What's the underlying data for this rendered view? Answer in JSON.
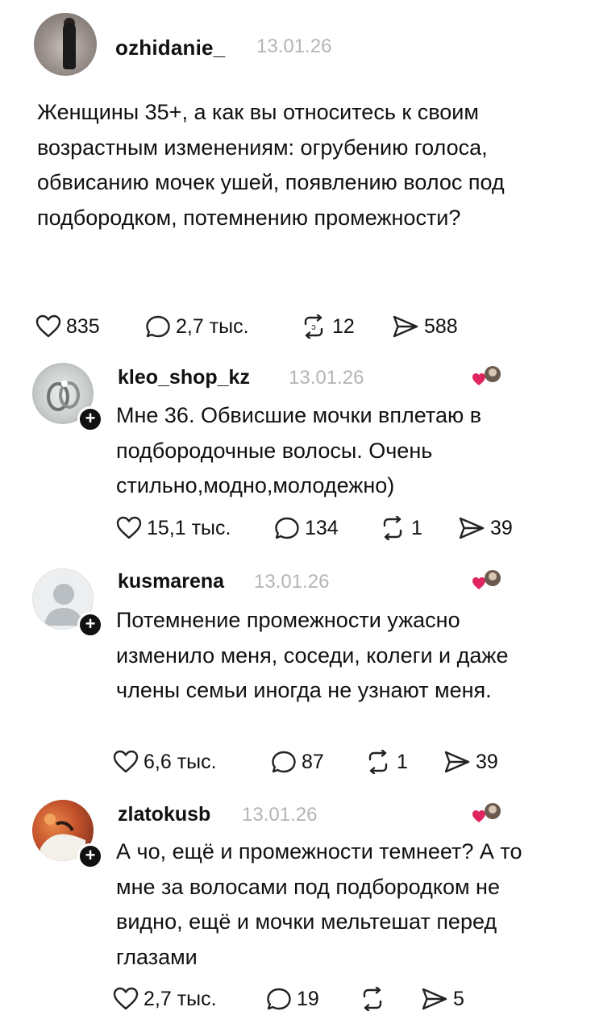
{
  "post": {
    "username": "ozhidanie_",
    "date": "13.01.26",
    "text": "Женщины 35+, а как вы относитесь к своим возрастным изменениям: огрубению голоса,  обвисанию мочек ушей, появлению волос под подбородком, потемнению промежности?",
    "likes": "835",
    "replies": "2,7 тыс.",
    "reposts": "12",
    "shares": "588"
  },
  "comments": [
    {
      "username": "kleo_shop_kz",
      "date": "13.01.26",
      "text": "Мне 36. Обвисшие мочки вплетаю в подбородочные волосы.  Очень стильно,модно,молодежно)",
      "likes": "15,1 тыс.",
      "replies": "134",
      "reposts": "1",
      "shares": "39"
    },
    {
      "username": "kusmarena",
      "date": "13.01.26",
      "text": "Потемнение промежности ужасно изменило меня,  соседи, колеги и даже члены семьи иногда не узнают меня.",
      "likes": "6,6 тыс.",
      "replies": "87",
      "reposts": "1",
      "shares": "39"
    },
    {
      "username": "zlatokusb",
      "date": "13.01.26",
      "text": "А чо, ещё и промежности темнеет? А то мне за волосами под подбородком не видно, ещё и мочки мельтешат перед глазами",
      "likes": "2,7 тыс.",
      "replies": "19",
      "reposts": "",
      "shares": "5"
    }
  ],
  "icons": {
    "like": "heart-outline-icon",
    "reply": "speech-bubble-icon",
    "repost": "repost-arrows-icon",
    "share": "send-plane-icon",
    "author_liked": "author-heart-avatar-icon",
    "follow": "plus-icon"
  },
  "colors": {
    "text": "#111111",
    "date": "#b5b5b5",
    "heart": "#e0245e"
  }
}
